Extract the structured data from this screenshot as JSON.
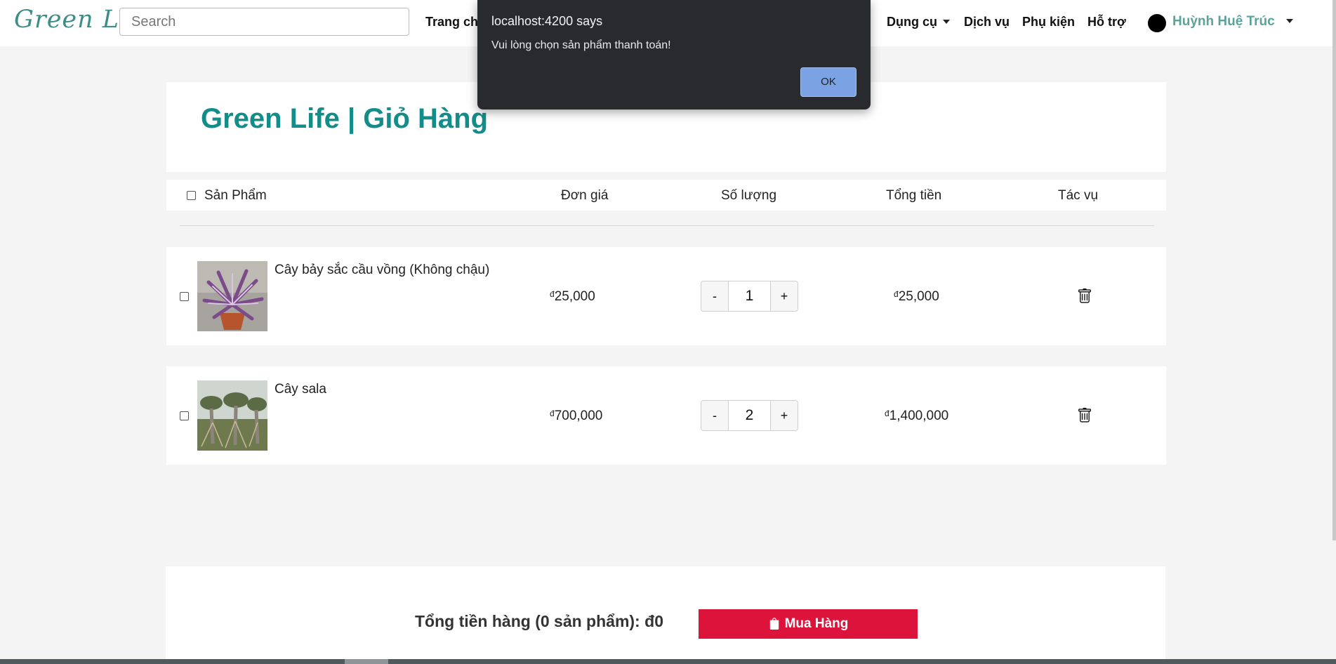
{
  "nav": {
    "brand": "Green Life",
    "search_placeholder": "Search",
    "links": {
      "home": "Trang chủ",
      "tools": "Dụng cụ",
      "services": "Dịch vụ",
      "accessories": "Phụ kiện",
      "support": "Hỗ trợ"
    },
    "user_name": "Huỳnh Huệ Trúc"
  },
  "page_title": "Green Life | Giỏ Hàng",
  "table_header": {
    "product": "Sản Phẩm",
    "unit_price": "Đơn giá",
    "quantity": "Số lượng",
    "total": "Tổng tiền",
    "actions": "Tác vụ"
  },
  "currency_symbol": "đ",
  "cart_items": [
    {
      "name": "Cây bảy sắc cầu vồng (Không chậu)",
      "unit_price": "25,000",
      "quantity": "1",
      "total": "25,000",
      "minus": "-",
      "plus": "+"
    },
    {
      "name": "Cây sala",
      "unit_price": "700,000",
      "quantity": "2",
      "total": "1,400,000",
      "minus": "-",
      "plus": "+"
    }
  ],
  "footer": {
    "total_label": "Tổng tiền hàng (0 sản phẩm): ",
    "total_value": "0",
    "buy_label": "Mua Hàng"
  },
  "dialog": {
    "title": "localhost:4200 says",
    "message": "Vui lòng chọn sản phẩm thanh toán!",
    "ok_label": "OK"
  },
  "icons": {
    "delete": "trash-icon",
    "buy": "shopping-bag-icon"
  }
}
